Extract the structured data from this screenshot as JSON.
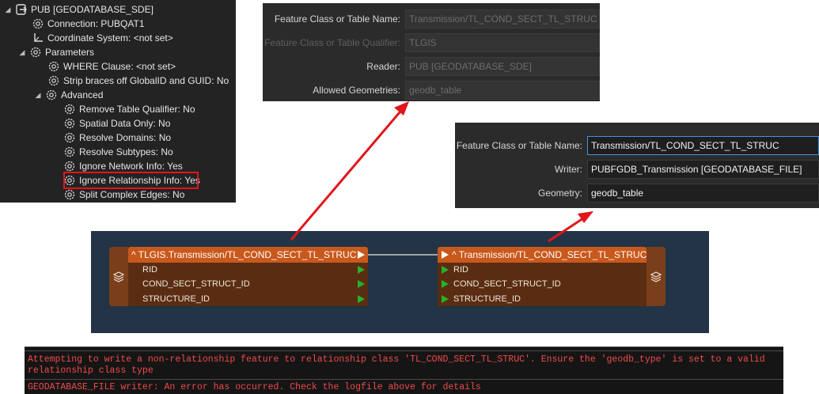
{
  "tree": {
    "root": "PUB [GEODATABASE_SDE]",
    "connection": "Connection: PUBQAT1",
    "coordinate_system": "Coordinate System: <not set>",
    "parameters": "Parameters",
    "where_clause": "WHERE Clause: <not set>",
    "strip_braces": "Strip braces off GlobalID and GUID: No",
    "advanced": "Advanced",
    "remove_table_qualifier": "Remove Table Qualifier: No",
    "spatial_data_only": "Spatial Data Only: No",
    "resolve_domains": "Resolve Domains: No",
    "resolve_subtypes": "Resolve Subtypes: No",
    "ignore_network_info": "Ignore Network Info: Yes",
    "ignore_relationship_info": "Ignore Relationship Info: Yes",
    "split_complex_edges": "Split Complex Edges: No"
  },
  "reader_dialog": {
    "feature_class_label": "Feature Class or Table Name:",
    "feature_class_value": "Transmission/TL_COND_SECT_TL_STRUC",
    "qualifier_label": "Feature Class or Table Qualifier:",
    "qualifier_value": "TLGIS",
    "reader_label": "Reader:",
    "reader_value": "PUB [GEODATABASE_SDE]",
    "geometries_label": "Allowed Geometries:",
    "geometries_value": "geodb_table"
  },
  "writer_dialog": {
    "feature_class_label": "Feature Class or Table Name:",
    "feature_class_value": "Transmission/TL_COND_SECT_TL_STRUC",
    "writer_label": "Writer:",
    "writer_value": "PUBFGDB_Transmission [GEODATABASE_FILE]",
    "geometry_label": "Geometry:",
    "geometry_value": "geodb_table"
  },
  "canvas": {
    "reader_ft": {
      "title": "TLGIS.Transmission/TL_COND_SECT_TL_STRUC",
      "attributes": [
        "RID",
        "COND_SECT_STRUCT_ID",
        "STRUCTURE_ID"
      ]
    },
    "writer_ft": {
      "title": "Transmission/TL_COND_SECT_TL_STRUC",
      "attributes": [
        "RID",
        "COND_SECT_STRUCT_ID",
        "STRUCTURE_ID"
      ]
    }
  },
  "log": {
    "line1": "Attempting to write a non-relationship feature to relationship class 'TL_COND_SECT_TL_STRUC'. Ensure the 'geodb_type' is set to a valid",
    "line2": "relationship class type",
    "line3": "GEODATABASE_FILE writer: An error has occurred. Check the logfile above for details"
  },
  "colors": {
    "highlight": "#e0161a",
    "arrow": "#e0161a",
    "feature_type_header": "#c8581b",
    "port": "#23b42b",
    "log_error": "#ef4a4a"
  }
}
